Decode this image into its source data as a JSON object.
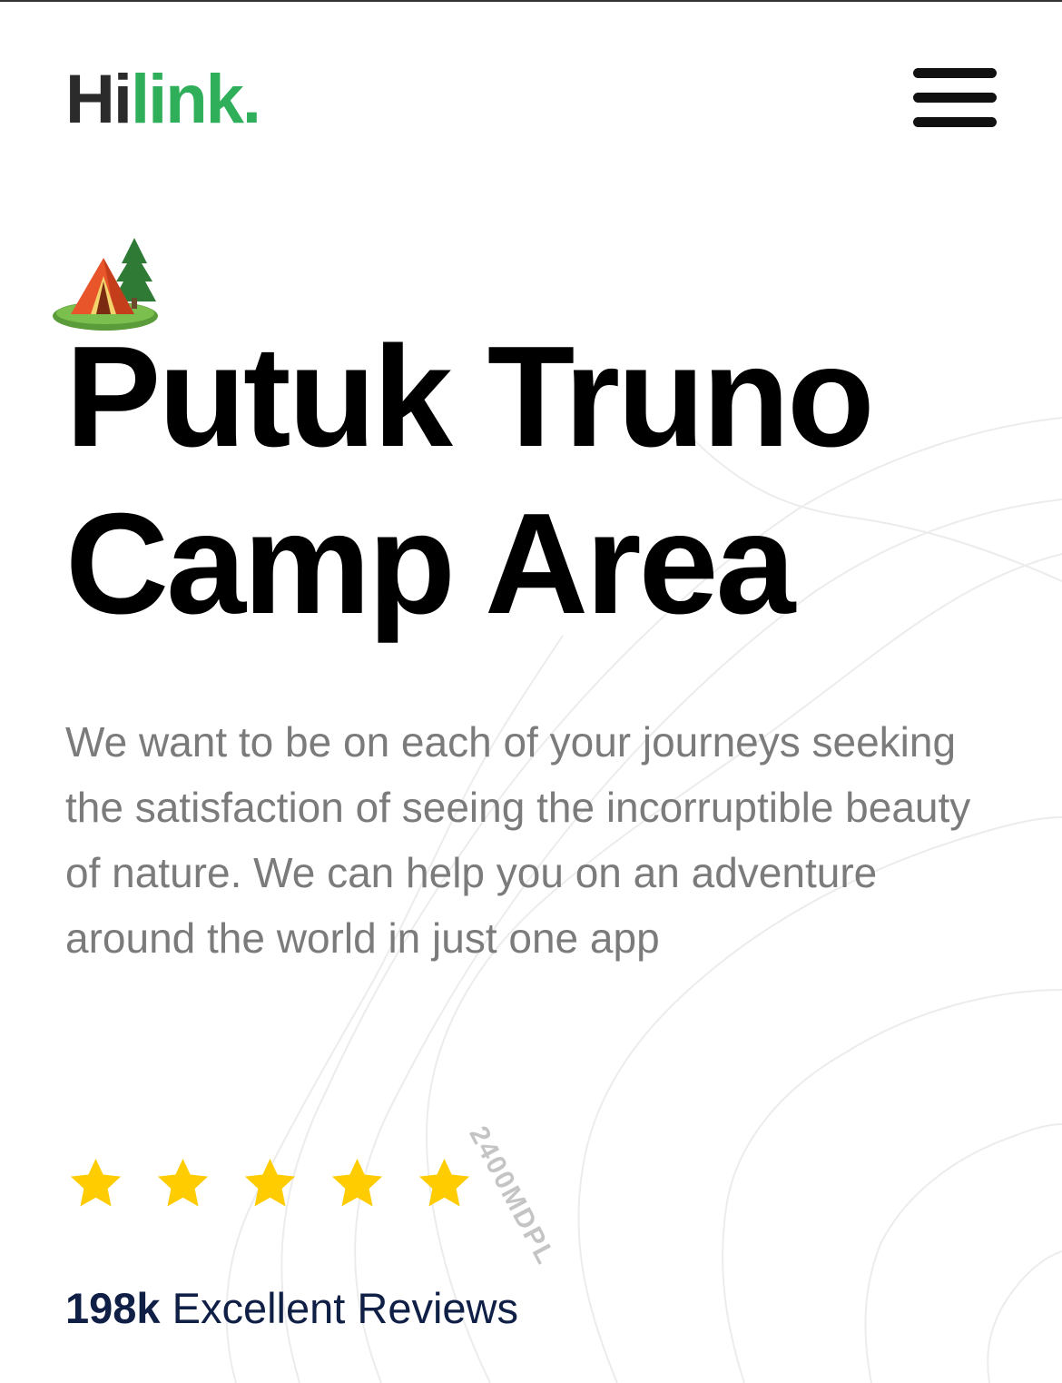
{
  "header": {
    "logo_part1": "Hi",
    "logo_part2": "link."
  },
  "hero": {
    "camp_icon": "camping-tent-icon",
    "title_line1": "Putuk Truno",
    "title_line2": "Camp Area",
    "description": "We want to be on each of your journeys seeking the satisfaction of seeing the incorruptible beauty of nature. We can help you on an adventure around the world in just one app"
  },
  "rating": {
    "stars": 5,
    "max_stars": 5,
    "count": "198k",
    "label": "Excellent Reviews"
  },
  "map": {
    "elevation_label": "2400MDPL"
  },
  "colors": {
    "brand_green": "#30af5b",
    "star_yellow": "#FFCC00",
    "text_gray": "#7b7b7b",
    "reviews_navy": "#0f1f45"
  }
}
